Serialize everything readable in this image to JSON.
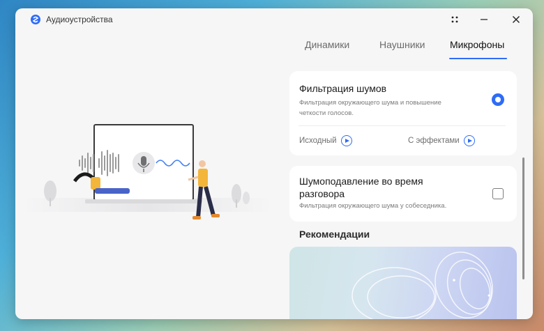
{
  "window": {
    "title": "Аудиоустройства"
  },
  "tabs": [
    {
      "label": "Динамики",
      "active": false
    },
    {
      "label": "Наушники",
      "active": false
    },
    {
      "label": "Микрофоны",
      "active": true
    }
  ],
  "noise_filter": {
    "title": "Фильтрация шумов",
    "description_line1": "Фильтрация окружающего шума и повышение",
    "description_line2": "четкости голосов.",
    "selected": true,
    "original_label": "Исходный",
    "effects_label": "С эффектами"
  },
  "call_suppression": {
    "title_line1": "Шумоподавление во время",
    "title_line2": "разговора",
    "description": "Фильтрация окружающего шума у собеседника.",
    "checked": false
  },
  "recommendations": {
    "title": "Рекомендации"
  },
  "colors": {
    "accent": "#2f6cf6",
    "window_bg": "#f6f6f7",
    "card_bg": "#ffffff"
  }
}
